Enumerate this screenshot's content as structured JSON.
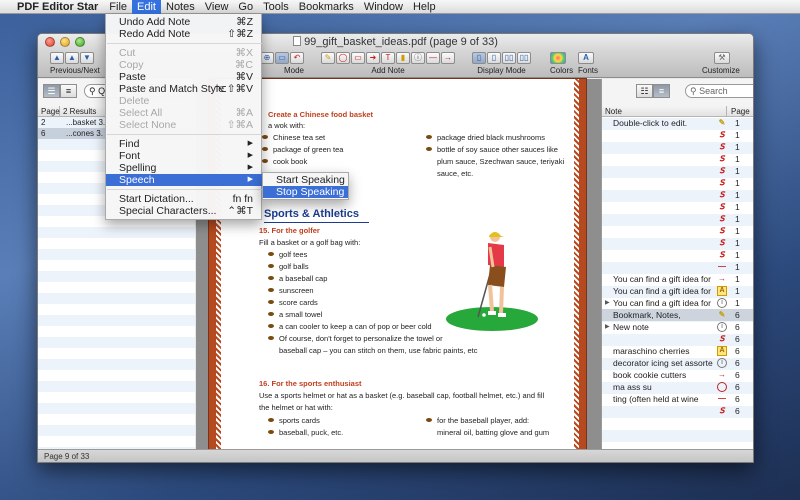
{
  "menubar": {
    "app": "PDF Editor Star",
    "items": [
      "File",
      "Edit",
      "Notes",
      "View",
      "Go",
      "Tools",
      "Bookmarks",
      "Window",
      "Help"
    ]
  },
  "window": {
    "title": "99_gift_basket_ideas.pdf (page 9 of 33)"
  },
  "toolbar": {
    "previous_next": "Previous/Next",
    "mode": "Mode",
    "add_note": "Add Note",
    "display_mode": "Display Mode",
    "colors": "Colors",
    "fonts": "Fonts",
    "customize": "Customize"
  },
  "left_panel": {
    "search_prefix": "Q",
    "columns": [
      "Page",
      "2 Results"
    ],
    "rows": [
      {
        "page": "2",
        "text": "...basket 3."
      },
      {
        "page": "6",
        "text": "...cones 3."
      }
    ]
  },
  "right_panel": {
    "search_placeholder": "Search",
    "columns": [
      "Note",
      "Page"
    ],
    "rows": [
      {
        "text": "Double-click to edit.",
        "icon": "pen",
        "page": "1"
      },
      {
        "text": "",
        "icon": "s",
        "page": "1"
      },
      {
        "text": "",
        "icon": "s",
        "page": "1"
      },
      {
        "text": "",
        "icon": "s",
        "page": "1"
      },
      {
        "text": "",
        "icon": "s",
        "page": "1"
      },
      {
        "text": "",
        "icon": "s",
        "page": "1"
      },
      {
        "text": "",
        "icon": "s",
        "page": "1"
      },
      {
        "text": "",
        "icon": "s",
        "page": "1"
      },
      {
        "text": "",
        "icon": "s",
        "page": "1"
      },
      {
        "text": "",
        "icon": "s",
        "page": "1"
      },
      {
        "text": "",
        "icon": "s",
        "page": "1"
      },
      {
        "text": "",
        "icon": "s",
        "page": "1"
      },
      {
        "text": "",
        "icon": "line",
        "page": "1"
      },
      {
        "text": "You can find a gift idea for",
        "icon": "arrow",
        "page": "1"
      },
      {
        "text": "You can find a gift idea for",
        "icon": "box",
        "page": "1"
      },
      {
        "text": "You can find a gift idea for",
        "icon": "info",
        "page": "1",
        "tri": true
      },
      {
        "text": "Bookmark, Notes,",
        "icon": "pen",
        "page": "6",
        "selected": true
      },
      {
        "text": "New note",
        "icon": "info",
        "page": "6",
        "tri": true
      },
      {
        "text": "",
        "icon": "s",
        "page": "6"
      },
      {
        "text": "maraschino cherries",
        "icon": "box",
        "page": "6"
      },
      {
        "text": "decorator icing set assorted",
        "icon": "info",
        "page": "6"
      },
      {
        "text": "book cookie cutters",
        "icon": "arrow",
        "page": "6"
      },
      {
        "text": "ma ass su",
        "icon": "circle",
        "page": "6"
      },
      {
        "text": "ting (often held at wine",
        "icon": "line",
        "page": "6"
      },
      {
        "text": "",
        "icon": "s",
        "page": "6"
      }
    ]
  },
  "document": {
    "h_chinese": "Create a Chinese food basket",
    "wok_with": "a wok with:",
    "col1": [
      "Chinese tea set",
      "package of green tea",
      "cook book"
    ],
    "col2": [
      "package dried black mushrooms",
      "bottle of soy sauce other sauces like",
      "plum sauce, Szechwan sauce, teriyaki",
      "sauce, etc."
    ],
    "section": "Sports & Athletics",
    "h15": "15.  For the golfer",
    "fill_golf": "Fill a basket or a golf bag with:",
    "golf_items": [
      "golf tees",
      "golf balls",
      "a baseball cap",
      "sunscreen",
      "score cards",
      "a small towel",
      "a can cooler to keep a can of pop or beer cold",
      "Of course, don't forget to personalize the towel or"
    ],
    "golf_cont": "baseball cap – you can stitch on them, use fabric paints, etc",
    "h16": "16.  For the sports enthusiast",
    "sports_p1": "Use a sports helmet or hat as a basket (e.g. baseball cap, football helmet, etc.) and fill",
    "sports_p2": "the helmet or hat with:",
    "s_col1": [
      "sports cards",
      "baseball, puck, etc."
    ],
    "s_col2a": "for the baseball player, add:",
    "s_col2b": "mineral oil, batting glove and gum"
  },
  "status": "Page 9 of 33",
  "edit_menu": [
    {
      "label": "Undo Add Note",
      "shortcut": "⌘Z",
      "enabled": true
    },
    {
      "label": "Redo Add Note",
      "shortcut": "⇧⌘Z",
      "enabled": true
    },
    {
      "sep": true
    },
    {
      "label": "Cut",
      "shortcut": "⌘X",
      "enabled": false
    },
    {
      "label": "Copy",
      "shortcut": "⌘C",
      "enabled": false
    },
    {
      "label": "Paste",
      "shortcut": "⌘V",
      "enabled": true
    },
    {
      "label": "Paste and Match Style",
      "shortcut": "⌥⇧⌘V",
      "enabled": true
    },
    {
      "label": "Delete",
      "shortcut": "",
      "enabled": false
    },
    {
      "label": "Select All",
      "shortcut": "⌘A",
      "enabled": false
    },
    {
      "label": "Select None",
      "shortcut": "⇧⌘A",
      "enabled": false
    },
    {
      "sep": true
    },
    {
      "label": "Find",
      "shortcut": "▶",
      "enabled": true
    },
    {
      "label": "Font",
      "shortcut": "▶",
      "enabled": true
    },
    {
      "label": "Spelling",
      "shortcut": "▶",
      "enabled": true
    },
    {
      "label": "Speech",
      "shortcut": "▶",
      "enabled": true,
      "highlight": true
    },
    {
      "sep": true
    },
    {
      "label": "Start Dictation...",
      "shortcut": "fn fn",
      "enabled": true
    },
    {
      "label": "Special Characters...",
      "shortcut": "⌃⌘T",
      "enabled": true
    }
  ],
  "speech_menu": [
    {
      "label": "Start Speaking"
    },
    {
      "label": "Stop Speaking",
      "highlight": true
    }
  ],
  "colors": {
    "menu_highlight": "#3b6fd6",
    "accent_red": "#c42020",
    "heading_orange": "#c0401e",
    "section_blue": "#1b3d8f",
    "border_brick": "#b54a20"
  }
}
